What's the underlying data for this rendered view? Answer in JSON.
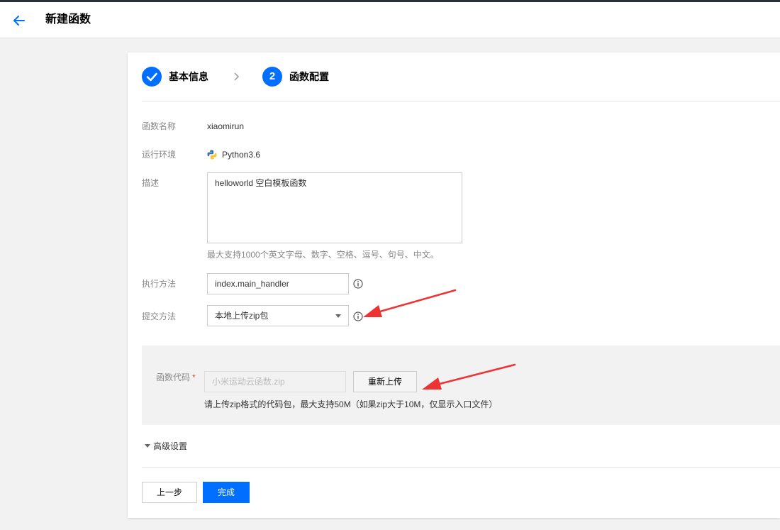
{
  "header": {
    "title": "新建函数"
  },
  "steps": [
    {
      "label": "基本信息",
      "state": "done"
    },
    {
      "number": "2",
      "label": "函数配置",
      "state": "active"
    }
  ],
  "form": {
    "function_name": {
      "label": "函数名称",
      "value": "xiaomirun"
    },
    "runtime": {
      "label": "运行环境",
      "value": "Python3.6",
      "icon": "python-icon"
    },
    "description": {
      "label": "描述",
      "value": "helloworld 空白模板函数",
      "hint": "最大支持1000个英文字母、数字、空格、逗号、句号、中文。"
    },
    "handler": {
      "label": "执行方法",
      "value": "index.main_handler"
    },
    "submit_method": {
      "label": "提交方法",
      "value": "本地上传zip包"
    },
    "code": {
      "label": "函数代码",
      "required_mark": "*",
      "file": "小米运动云函数.zip",
      "reupload_label": "重新上传",
      "hint": "请上传zip格式的代码包，最大支持50M（如果zip大于10M，仅显示入口文件）"
    },
    "advanced": {
      "label": "高级设置"
    }
  },
  "footer": {
    "prev_label": "上一步",
    "finish_label": "完成"
  },
  "colors": {
    "primary": "#006eff",
    "annotation_arrow": "#ee3333"
  }
}
